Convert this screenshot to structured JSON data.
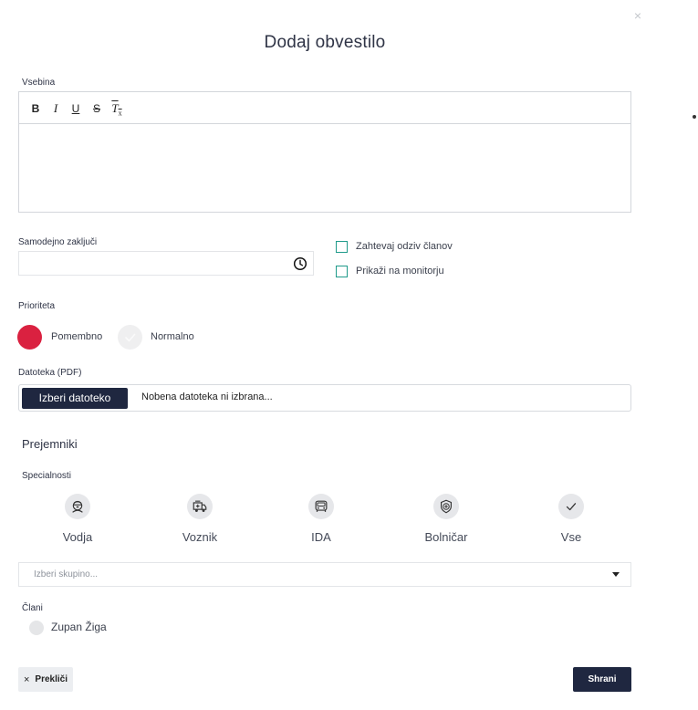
{
  "dialog": {
    "title": "Dodaj obvestilo",
    "close_glyph": "×"
  },
  "content": {
    "label": "Vsebina",
    "toolbar": {
      "bold": "B",
      "italic": "I",
      "underline": "U",
      "strike": "S",
      "clear": "T"
    },
    "value": ""
  },
  "auto_close": {
    "label": "Samodejno zaključi",
    "value": ""
  },
  "options": {
    "request_response": "Zahtevaj odziv članov",
    "show_on_monitor": "Prikaži na monitorju"
  },
  "priority": {
    "label": "Prioriteta",
    "important": "Pomembno",
    "normal": "Normalno",
    "important_color": "#da2140"
  },
  "file": {
    "label": "Datoteka (PDF)",
    "button": "Izberi datoteko",
    "status": "Nobena datoteka ni izbrana..."
  },
  "recipients": {
    "heading": "Prejemniki",
    "specialties_label": "Specialnosti",
    "specialties": [
      {
        "label": "Vodja",
        "icon": "leader-icon"
      },
      {
        "label": "Voznik",
        "icon": "ambulance-icon"
      },
      {
        "label": "IDA",
        "icon": "vehicle-icon"
      },
      {
        "label": "Bolničar",
        "icon": "medic-shield-icon"
      },
      {
        "label": "Vse",
        "icon": "checkmark-icon"
      }
    ],
    "group_placeholder": "Izberi skupino...",
    "members_label": "Člani",
    "members": [
      {
        "name": "Zupan Žiga"
      }
    ]
  },
  "footer": {
    "cancel": "Prekliči",
    "save": "Shrani"
  },
  "colors": {
    "primary_dark": "#1f2740",
    "checkbox_teal": "#1f9a8a",
    "danger_red": "#da2140"
  }
}
